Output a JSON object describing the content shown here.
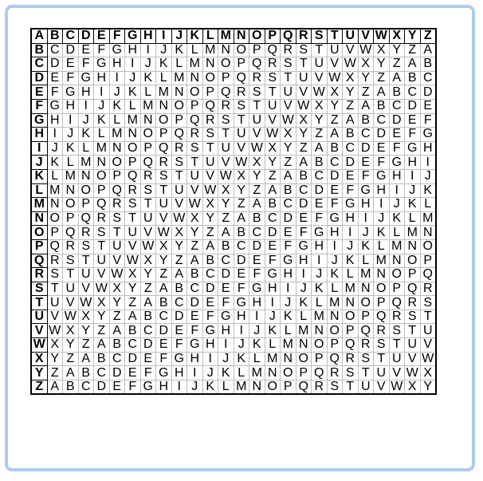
{
  "alphabet": [
    "A",
    "B",
    "C",
    "D",
    "E",
    "F",
    "G",
    "H",
    "I",
    "J",
    "K",
    "L",
    "M",
    "N",
    "O",
    "P",
    "Q",
    "R",
    "S",
    "T",
    "U",
    "V",
    "W",
    "X",
    "Y",
    "Z"
  ],
  "colors": {
    "frame_border": "#aecbeb",
    "grid_line": "#bdbdbd",
    "header_line": "#000000",
    "text": "#000000"
  }
}
